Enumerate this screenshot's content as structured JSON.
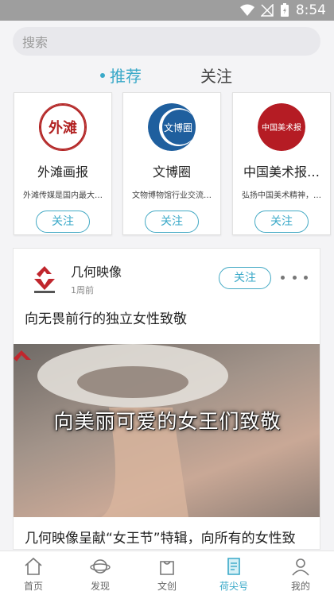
{
  "status_bar": {
    "time": "8:54"
  },
  "search": {
    "placeholder": "搜索"
  },
  "tabs": [
    {
      "label": "推荐",
      "active": true
    },
    {
      "label": "关注",
      "active": false
    }
  ],
  "accounts": [
    {
      "name": "外滩画报",
      "desc": "外滩传媒是国内最大…",
      "follow_label": "关注",
      "logo_text": "外滩",
      "logo_color": "#b22222"
    },
    {
      "name": "文博圈",
      "desc": "文物博物馆行业交流…",
      "follow_label": "关注",
      "logo_text": "文博圈",
      "logo_color": "#1f5f9e"
    },
    {
      "name": "中国美术报…",
      "desc": "弘扬中国美术精神，…",
      "follow_label": "关注",
      "logo_text": "中国美术报",
      "logo_color": "#b51c24"
    }
  ],
  "post": {
    "author": "几何映像",
    "time": "1周前",
    "follow_label": "关注",
    "title": "向无畏前行的独立女性致敬",
    "image_caption": "向美丽可爱的女王们致敬",
    "subtitle": "几何映像呈献“女王节”特辑，向所有的女性致"
  },
  "bottom_nav": [
    {
      "label": "首页",
      "icon": "home-icon",
      "active": false
    },
    {
      "label": "发现",
      "icon": "planet-icon",
      "active": false
    },
    {
      "label": "文创",
      "icon": "bag-icon",
      "active": false
    },
    {
      "label": "荷尖号",
      "icon": "document-icon",
      "active": true
    },
    {
      "label": "我的",
      "icon": "user-icon",
      "active": false
    }
  ],
  "colors": {
    "accent": "#3aa9c8",
    "status_bar": "#9e9e9e"
  }
}
